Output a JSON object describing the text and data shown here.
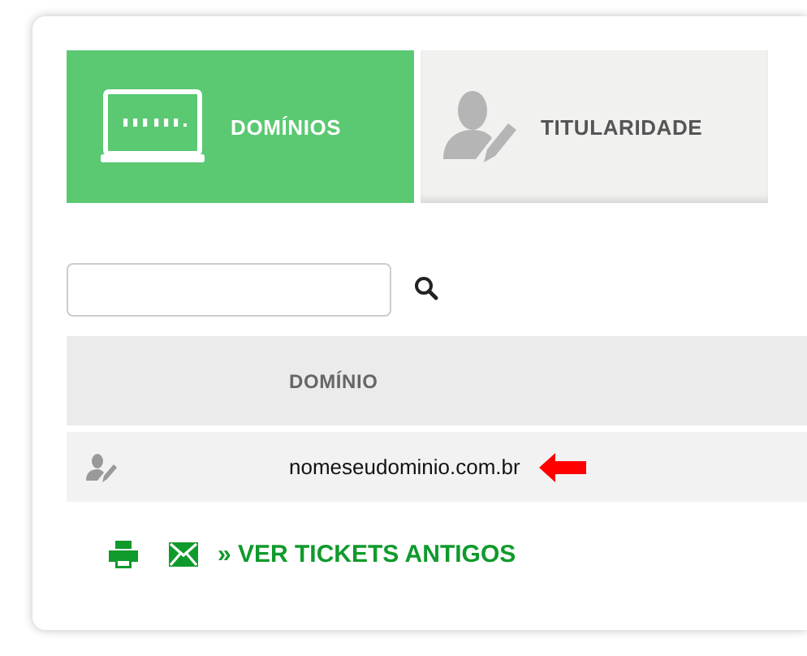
{
  "tabs": [
    {
      "kind": "domains",
      "label": "DOMÍNIOS",
      "selected": true
    },
    {
      "kind": "ownership",
      "label": "TITULARIDADE",
      "selected": false
    }
  ],
  "table": {
    "columns": [
      "DOMÍNIO"
    ],
    "rows": [
      {
        "domain": "nomeseudominio.com.br",
        "highlighted": true
      }
    ]
  },
  "footer": {
    "link": "» VER TICKETS ANTIGOS"
  }
}
